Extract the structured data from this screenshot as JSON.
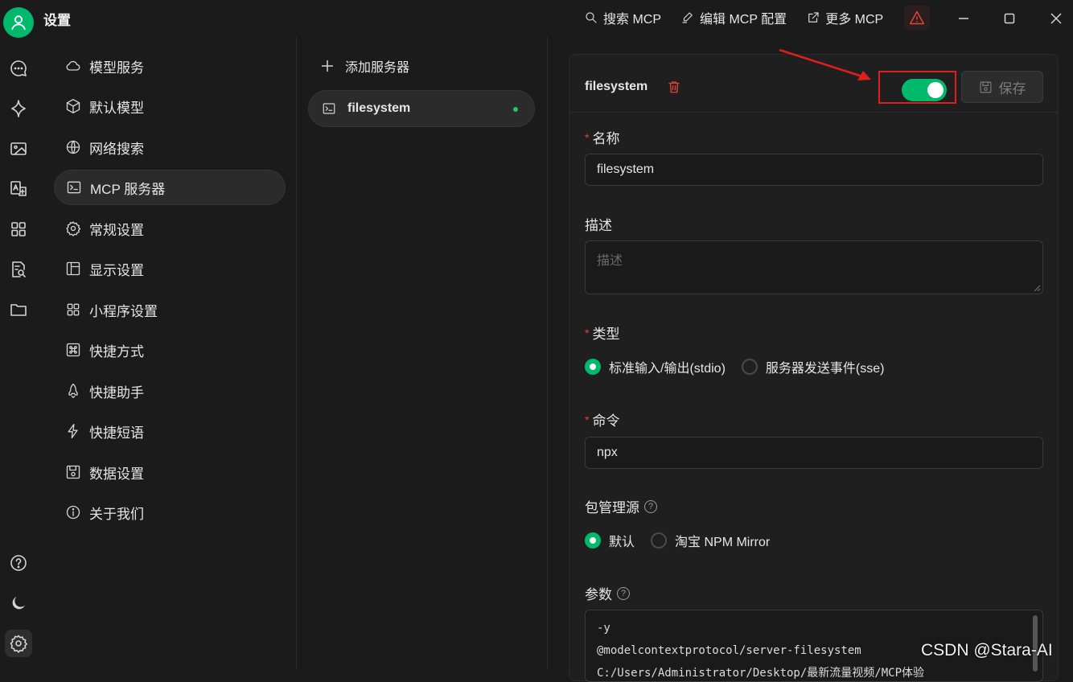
{
  "window": {
    "title": "设置",
    "actions": [
      {
        "label": "搜索 MCP",
        "icon": "search-icon"
      },
      {
        "label": "编辑 MCP 配置",
        "icon": "edit-icon"
      },
      {
        "label": "更多 MCP",
        "icon": "external-link-icon"
      }
    ]
  },
  "nav": {
    "items": [
      {
        "label": "模型服务",
        "icon": "cloud-icon"
      },
      {
        "label": "默认模型",
        "icon": "cube-icon"
      },
      {
        "label": "网络搜索",
        "icon": "globe-icon"
      },
      {
        "label": "MCP 服务器",
        "icon": "terminal-icon",
        "active": true
      },
      {
        "label": "常规设置",
        "icon": "gear-icon"
      },
      {
        "label": "显示设置",
        "icon": "layout-icon"
      },
      {
        "label": "小程序设置",
        "icon": "grid-icon"
      },
      {
        "label": "快捷方式",
        "icon": "command-icon"
      },
      {
        "label": "快捷助手",
        "icon": "rocket-icon"
      },
      {
        "label": "快捷短语",
        "icon": "zap-icon"
      },
      {
        "label": "数据设置",
        "icon": "save-icon"
      },
      {
        "label": "关于我们",
        "icon": "info-icon"
      }
    ]
  },
  "servers": {
    "add_label": "添加服务器",
    "items": [
      {
        "name": "filesystem",
        "status": "active"
      }
    ]
  },
  "detail": {
    "name": "filesystem",
    "enabled": true,
    "save_label": "保存",
    "fields": {
      "name_label": "名称",
      "name_value": "filesystem",
      "desc_label": "描述",
      "desc_placeholder": "描述",
      "type_label": "类型",
      "type_options": [
        "标准输入/输出(stdio)",
        "服务器发送事件(sse)"
      ],
      "type_selected": 0,
      "command_label": "命令",
      "command_value": "npx",
      "registry_label": "包管理源",
      "registry_options": [
        "默认",
        "淘宝 NPM Mirror"
      ],
      "registry_selected": 0,
      "args_label": "参数",
      "args_lines": [
        "-y",
        "@modelcontextprotocol/server-filesystem",
        "C:/Users/Administrator/Desktop/最新流量视频/MCP体验"
      ]
    }
  },
  "watermark": "CSDN @Stara-AI",
  "colors": {
    "accent": "#00b96b",
    "danger": "#e0443a",
    "highlight": "#e01e1e"
  }
}
